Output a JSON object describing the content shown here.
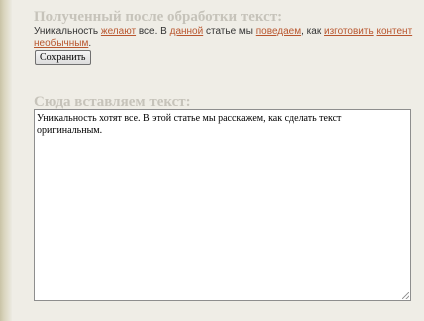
{
  "result_section": {
    "heading": "Полученный после обработки текст:",
    "segments": [
      {
        "text": "Уникальность ",
        "link": false
      },
      {
        "text": "желают",
        "link": true
      },
      {
        "text": " все. В ",
        "link": false
      },
      {
        "text": "данной",
        "link": true
      },
      {
        "text": " статье мы ",
        "link": false
      },
      {
        "text": "поведаем",
        "link": true
      },
      {
        "text": ", как ",
        "link": false
      },
      {
        "text": "изготовить",
        "link": true
      },
      {
        "text": " ",
        "link": false
      },
      {
        "text": "контент",
        "link": true
      },
      {
        "text": " ",
        "link": false
      },
      {
        "text": "необычным",
        "link": true
      },
      {
        "text": ".",
        "link": false
      }
    ],
    "save_label": "Сохранить"
  },
  "input_section": {
    "heading": "Сюда вставляем текст:",
    "textarea_value": "Уникальность хотят все. В этой статье мы расскажем, как сделать текст оригинальным."
  },
  "colors": {
    "background": "#efede6",
    "heading": "#c6c3ba",
    "link": "#b9562e"
  }
}
